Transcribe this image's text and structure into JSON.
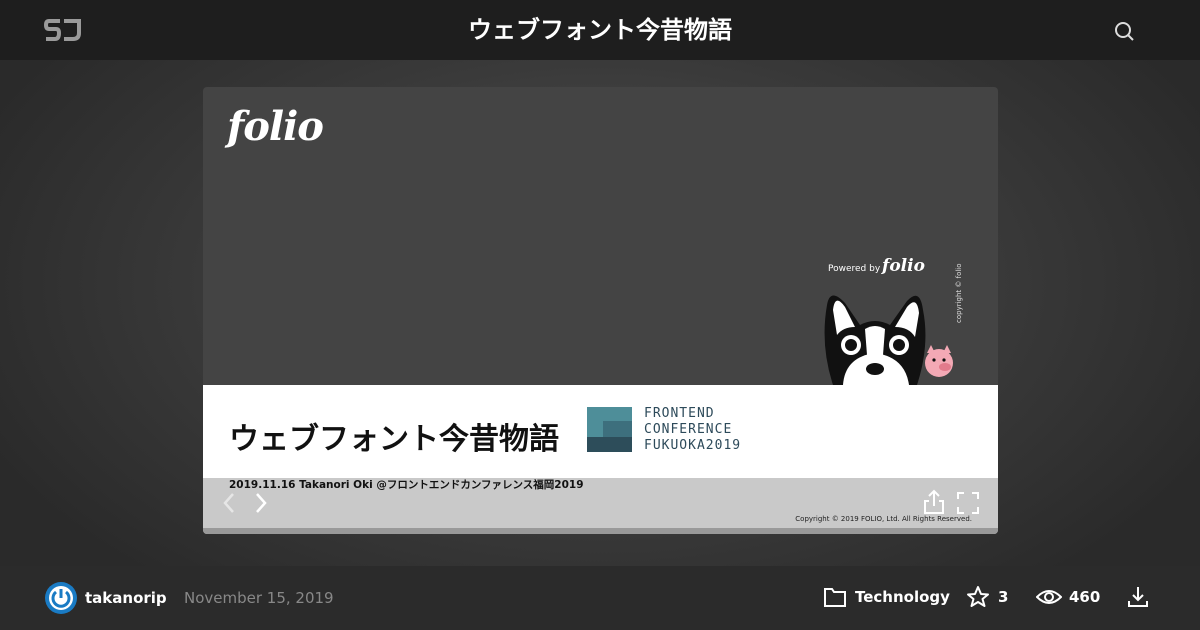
{
  "header": {
    "logo_text": "SJ",
    "title": "ウェブフォント今昔物語"
  },
  "slide": {
    "folio_logo": "folio",
    "powered_by": "Powered by",
    "powered_logo": "folio",
    "copyright_vertical": "copyright © folio",
    "title": "ウェブフォント今昔物語",
    "conference_lines": [
      "FRONTEND",
      "CONFERENCE",
      "FUKUOKA2019"
    ],
    "subtitle": "2019.11.16 Takanori Oki @フロントエンドカンファレンス福岡2019",
    "copyright": "Copyright © 2019 FOLIO, Ltd. All Rights Reserved."
  },
  "footer": {
    "author": "takanorip",
    "date": "November 15, 2019",
    "category": "Technology",
    "stars": "3",
    "views": "460"
  },
  "colors": {
    "topbar": "#1e1e1e",
    "bottombar": "#2b2b2b",
    "slide_bg": "#444444",
    "conf_teal": "#3d7a86",
    "avatar_blue": "#1a7bc4"
  },
  "icons": [
    "sj-logo-icon",
    "search-icon",
    "chevron-left-icon",
    "chevron-right-icon",
    "share-icon",
    "fullscreen-icon",
    "power-avatar-icon",
    "folder-icon",
    "star-icon",
    "eye-icon",
    "download-icon"
  ]
}
